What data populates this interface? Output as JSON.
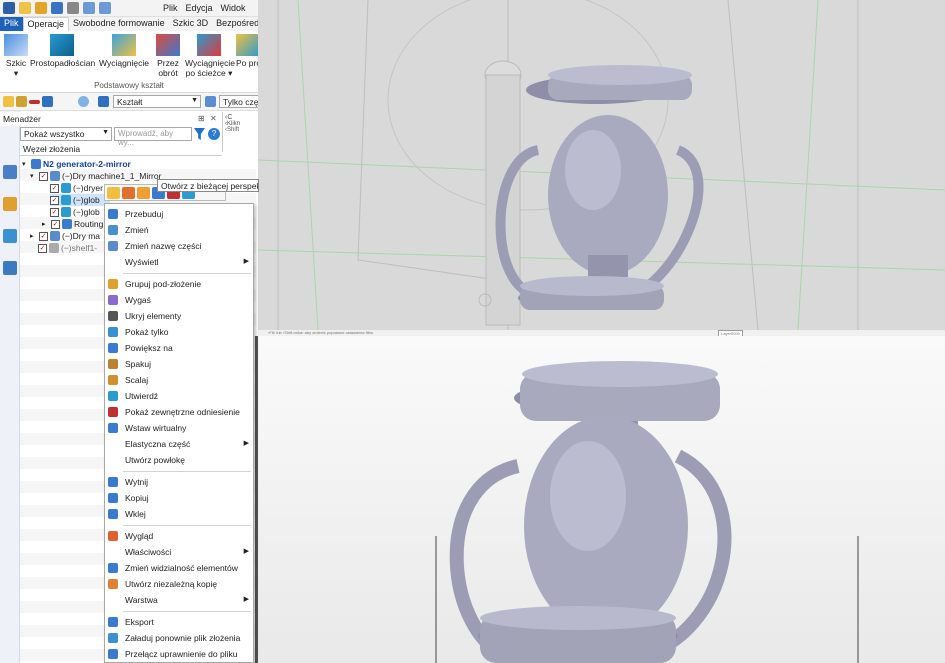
{
  "menubar": {
    "plik": "Plik",
    "edycja": "Edycja",
    "widok": "Widok"
  },
  "tabs": [
    "Plik",
    "Operacje",
    "Swobodne formowanie",
    "Szkic 3D",
    "Bezpośrednia ed"
  ],
  "ribbon": {
    "buttons": [
      {
        "l1": "Szkic",
        "l2": "▾"
      },
      {
        "l1": "Prostopadłościan",
        "l2": ""
      },
      {
        "l1": "Wyciągnięcie",
        "l2": ""
      },
      {
        "l1": "Przez",
        "l2": "obrót"
      },
      {
        "l1": "Wyciągnięcie",
        "l2": "po ścieżce ▾"
      },
      {
        "l1": "Po pro",
        "l2": ""
      }
    ],
    "group_label": "Podstawowy kształt"
  },
  "toolbar": {
    "shape_select": "Kształt",
    "filter_select": "Tylko częś"
  },
  "manager": {
    "title": "Menadżer",
    "filter_value": "Pokaż wszystko",
    "search_placeholder": "Wprowadź, aby wy...",
    "node_header": "Węzeł złożenia",
    "help": "?"
  },
  "tree": [
    {
      "text": "N2 generator-2-mirror",
      "indent": 0,
      "checkbox": false,
      "expander": "▾"
    },
    {
      "text": "(−)Dry machine1_1_Mirror",
      "indent": 1,
      "checkbox": true,
      "expander": "▾"
    },
    {
      "text": "(−)dryer",
      "indent": 2,
      "checkbox": true,
      "expander": ""
    },
    {
      "text": "(−)glob",
      "indent": 2,
      "checkbox": true,
      "expander": ""
    },
    {
      "text": "(−)glob",
      "indent": 2,
      "checkbox": true,
      "expander": ""
    },
    {
      "text": "Routing",
      "indent": 2,
      "checkbox": true,
      "expander": "▸"
    },
    {
      "text": "(−)Dry ma",
      "indent": 1,
      "checkbox": true,
      "expander": "▸"
    },
    {
      "text": "(−)shelf1-",
      "indent": 1,
      "checkbox": true,
      "expander": ""
    }
  ],
  "right_panel": {
    "l1": "‹C",
    "l2": "‹Klikn",
    "l3": "‹Shift"
  },
  "tooltip": "Otwórz z bieżącej perspektywy",
  "context_menu": [
    {
      "label": "Przebuduj",
      "sub": false
    },
    {
      "label": "Zmień",
      "sub": false
    },
    {
      "label": "Zmień nazwę części",
      "sub": false
    },
    {
      "label": "Wyświetl",
      "sub": true
    },
    {
      "label": "Grupuj pod-złożenie",
      "sub": false
    },
    {
      "label": "Wygaś",
      "sub": false
    },
    {
      "label": "Ukryj elementy",
      "sub": false
    },
    {
      "label": "Pokaż tylko",
      "sub": false
    },
    {
      "label": "Powiększ na",
      "sub": false
    },
    {
      "label": "Spakuj",
      "sub": false
    },
    {
      "label": "Scalaj",
      "sub": false
    },
    {
      "label": "Utwierdź",
      "sub": false
    },
    {
      "label": "Pokaż zewnętrzne odniesienie",
      "sub": false
    },
    {
      "label": "Wstaw wirtualny",
      "sub": false
    },
    {
      "label": "Elastyczna część",
      "sub": true
    },
    {
      "label": "Utwórz powłokę",
      "sub": false
    },
    {
      "label": "Wytnij",
      "sub": false
    },
    {
      "label": "Kopiuj",
      "sub": false
    },
    {
      "label": "Wklej",
      "sub": false
    },
    {
      "label": "Wygląd",
      "sub": false
    },
    {
      "label": "Właściwości",
      "sub": true
    },
    {
      "label": "Zmień widzialność elementów",
      "sub": false
    },
    {
      "label": "Utwórz niezależną kopię",
      "sub": false
    },
    {
      "label": "Warstwa",
      "sub": true
    },
    {
      "label": "Eksport",
      "sub": false
    },
    {
      "label": "Załaduj ponownie plik złożenia",
      "sub": false
    },
    {
      "label": "Przełącz uprawnienie do pliku",
      "sub": false
    }
  ],
  "viewport": {
    "status_hint": "‹F8› lub ‹Shift-rolka› aby zmienić poprawne ustawienia filtru",
    "layer": "Layer0000"
  },
  "colors": {
    "file_tab": "#1d62b8",
    "accent_blue": "#1a6fd1",
    "model_gray": "#a9a9bd"
  }
}
